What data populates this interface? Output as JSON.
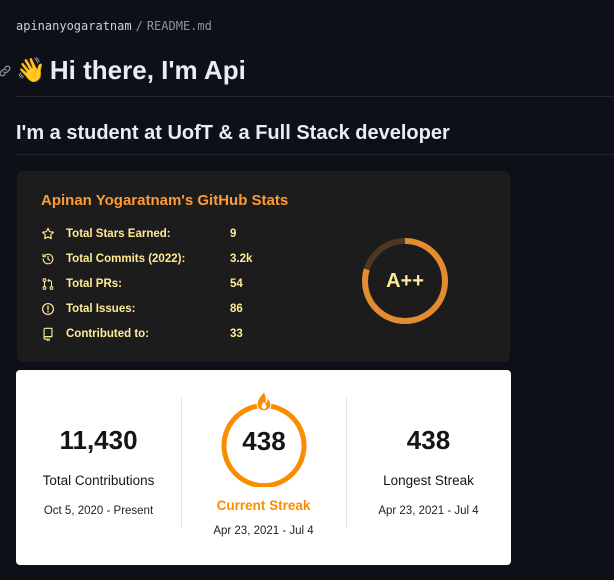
{
  "breadcrumb": {
    "repo": "apinanyogaratnam",
    "separator": "/",
    "file": "README.md"
  },
  "heading": {
    "emoji": "👋",
    "text": "Hi there, I'm Api"
  },
  "subheading": "I'm a student at UofT & a Full Stack developer",
  "stats_card": {
    "title": "Apinan Yogaratnam's GitHub Stats",
    "rows": [
      {
        "icon": "star-icon",
        "label": "Total Stars Earned:",
        "value": "9"
      },
      {
        "icon": "history-icon",
        "label": "Total Commits (2022):",
        "value": "3.2k"
      },
      {
        "icon": "pull-request-icon",
        "label": "Total PRs:",
        "value": "54"
      },
      {
        "icon": "issue-icon",
        "label": "Total Issues:",
        "value": "86"
      },
      {
        "icon": "repo-icon",
        "label": "Contributed to:",
        "value": "33"
      }
    ],
    "rank": "A++",
    "colors": {
      "title": "#fe9b37",
      "text": "#ffeb95",
      "ring": "#e48d30",
      "background": "#1c1c1c"
    }
  },
  "streak_card": {
    "total": {
      "value": "11,430",
      "label": "Total Contributions",
      "range": "Oct 5, 2020 - Present"
    },
    "current": {
      "value": "438",
      "label": "Current Streak",
      "range": "Apr 23, 2021 - Jul 4"
    },
    "longest": {
      "value": "438",
      "label": "Longest Streak",
      "range": "Apr 23, 2021 - Jul 4"
    },
    "colors": {
      "accent": "#fb8c00",
      "background": "#ffffff"
    }
  }
}
